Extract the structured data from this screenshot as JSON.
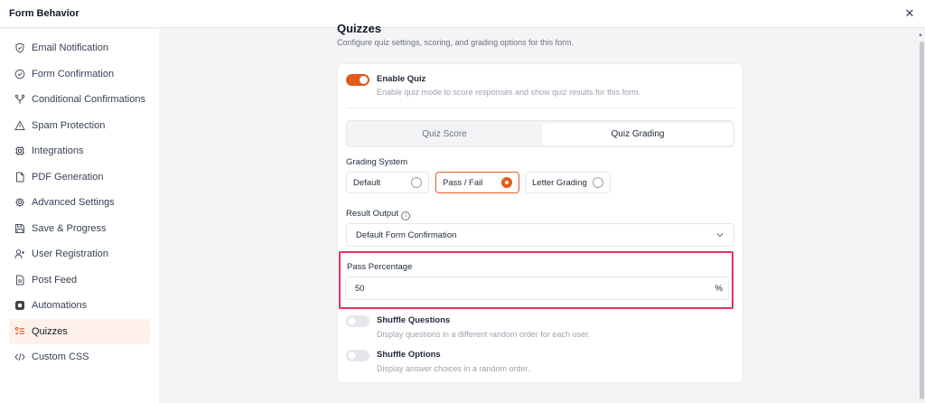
{
  "window": {
    "title": "Form Behavior",
    "close_icon": "close-icon"
  },
  "sidebar": {
    "items": [
      {
        "label": "Email Notification",
        "icon": "shield-check-icon"
      },
      {
        "label": "Form Confirmation",
        "icon": "check-circle-icon"
      },
      {
        "label": "Conditional Confirmations",
        "icon": "branch-icon"
      },
      {
        "label": "Spam Protection",
        "icon": "warning-triangle-icon"
      },
      {
        "label": "Integrations",
        "icon": "chip-icon"
      },
      {
        "label": "PDF Generation",
        "icon": "file-icon"
      },
      {
        "label": "Advanced Settings",
        "icon": "gear-icon"
      },
      {
        "label": "Save & Progress",
        "icon": "save-icon"
      },
      {
        "label": "User Registration",
        "icon": "user-plus-icon"
      },
      {
        "label": "Post Feed",
        "icon": "document-icon"
      },
      {
        "label": "Automations",
        "icon": "automation-icon"
      },
      {
        "label": "Quizzes",
        "icon": "quiz-list-icon",
        "active": true
      },
      {
        "label": "Custom CSS",
        "icon": "code-icon"
      }
    ]
  },
  "main": {
    "title": "Quizzes",
    "description": "Configure quiz settings, scoring, and grading options for this form.",
    "enable_quiz": {
      "label": "Enable Quiz",
      "description": "Enable quiz mode to score responses and show quiz results for this form.",
      "on": true
    },
    "tabs": [
      {
        "label": "Quiz Score",
        "active": false
      },
      {
        "label": "Quiz Grading",
        "active": true
      }
    ],
    "grading_system": {
      "label": "Grading System",
      "options": [
        {
          "label": "Default",
          "selected": false
        },
        {
          "label": "Pass / Fail",
          "selected": true
        },
        {
          "label": "Letter Grading",
          "selected": false
        }
      ]
    },
    "result_output": {
      "label": "Result Output",
      "info_icon": "info-icon",
      "value": "Default Form Confirmation"
    },
    "pass_percentage": {
      "label": "Pass Percentage",
      "value": "50",
      "unit": "%"
    },
    "shuffle_questions": {
      "label": "Shuffle Questions",
      "description": "Display questions in a different random order for each user.",
      "on": false
    },
    "shuffle_options": {
      "label": "Shuffle Options",
      "description": "Display answer choices in a random order.",
      "on": false
    }
  },
  "colors": {
    "accent": "#e25b1c",
    "highlight_border": "#e0325e",
    "active_bg": "#fdf1ea"
  }
}
